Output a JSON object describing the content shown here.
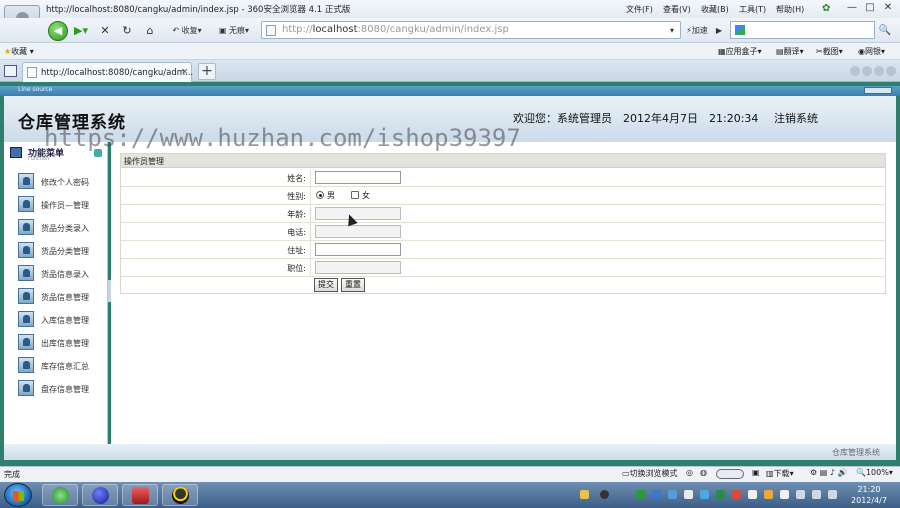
{
  "browser": {
    "window_title": "http://localhost:8080/cangku/admin/index.jsp - 360安全浏览器 4.1 正式版",
    "menu": [
      "文件(F)",
      "查看(V)",
      "收藏(B)",
      "工具(T)",
      "帮助(H)"
    ],
    "win_buttons": [
      "—",
      "□",
      "✕"
    ],
    "back_label": "收复",
    "none_label": "无痕",
    "address_prefix": "http://",
    "address_host": "localhost",
    "address_rest": ":8080/cangku/admin/index.jsp",
    "speed_label": "加速",
    "favorites_label": "收藏",
    "fav_right": [
      "应用盒子",
      "翻译",
      "截图",
      "网银"
    ],
    "tab_title": "http://localhost:8080/cangku/adm...",
    "tab_close": "×",
    "new_tab": "+"
  },
  "app": {
    "strip_text": "Line source",
    "system_title": "仓库管理系统",
    "welcome": "欢迎您：系统管理员　2012年4月7日　21:20:34",
    "logout": "注销系统",
    "footer_text": "仓库管理系统"
  },
  "sidebar": {
    "header": "功能菜单",
    "header_sub": "Function",
    "items": [
      "修改个人密码",
      "操作员—管理",
      "货品分类录入",
      "货品分类管理",
      "货品信息录入",
      "货品信息管理",
      "入库信息管理",
      "出库信息管理",
      "库存信息汇总",
      "盘存信息管理"
    ]
  },
  "form": {
    "section_title": "操作员管理",
    "name_label": "姓名:",
    "gender_label": "性别:",
    "gender_male": "男",
    "gender_female": "女",
    "age_label": "年龄:",
    "phone_label": "电话:",
    "address_label": "住址:",
    "title_label": "职位:",
    "submit": "提交",
    "reset": "重置"
  },
  "status": {
    "left": "完成",
    "switch_mode": "切换浏览模式",
    "download": "下载",
    "zoom": "100%"
  },
  "taskbar": {
    "time": "21:20",
    "date": "2012/4/7"
  },
  "watermark": "https://www.huzhan.com/ishop39397"
}
